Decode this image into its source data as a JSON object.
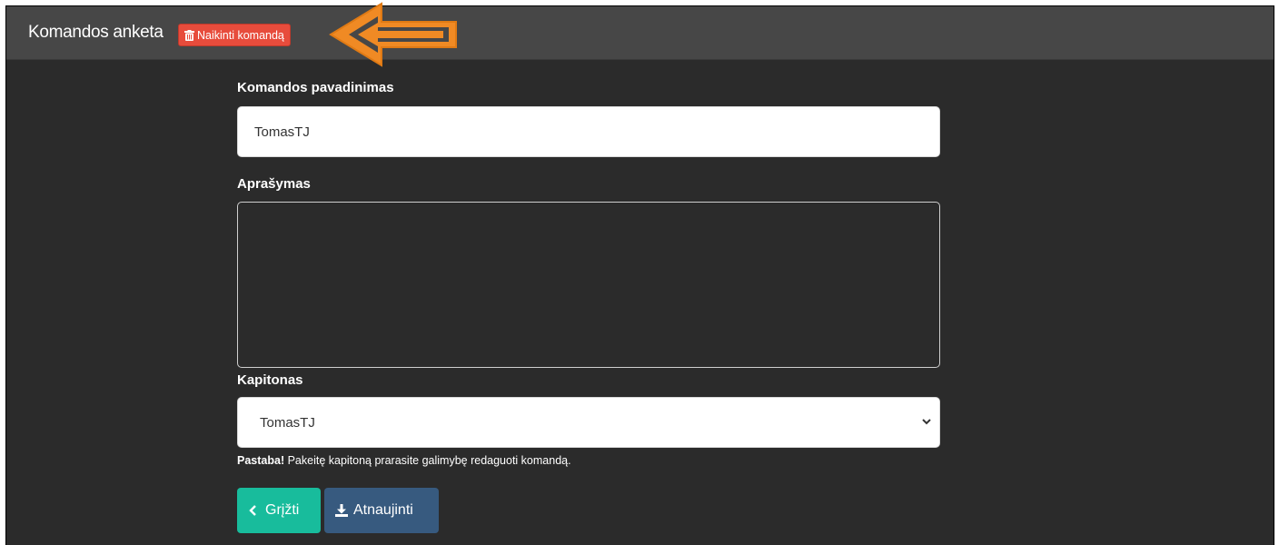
{
  "header": {
    "title": "Komandos anketa",
    "delete_label": "Naikinti komandą"
  },
  "form": {
    "name_label": "Komandos pavadinimas",
    "name_value": "TomasTJ",
    "description_label": "Aprašymas",
    "description_value": "",
    "captain_label": "Kapitonas",
    "captain_selected": "TomasTJ",
    "note_strong": "Pastaba!",
    "note_text": " Pakeitę kapitoną prarasite galimybę redaguoti komandą."
  },
  "actions": {
    "back_label": "Grįžti",
    "update_label": "Atnaujinti"
  },
  "colors": {
    "delete": "#e74c3c",
    "back": "#18bc9c",
    "update": "#375a7f",
    "annotation_arrow": "#f08a24"
  },
  "icons": {
    "delete": "trash-icon",
    "back": "chevron-left-icon",
    "update": "download-icon",
    "select": "chevron-down-icon",
    "annotation": "arrow-left-annotation-icon"
  }
}
